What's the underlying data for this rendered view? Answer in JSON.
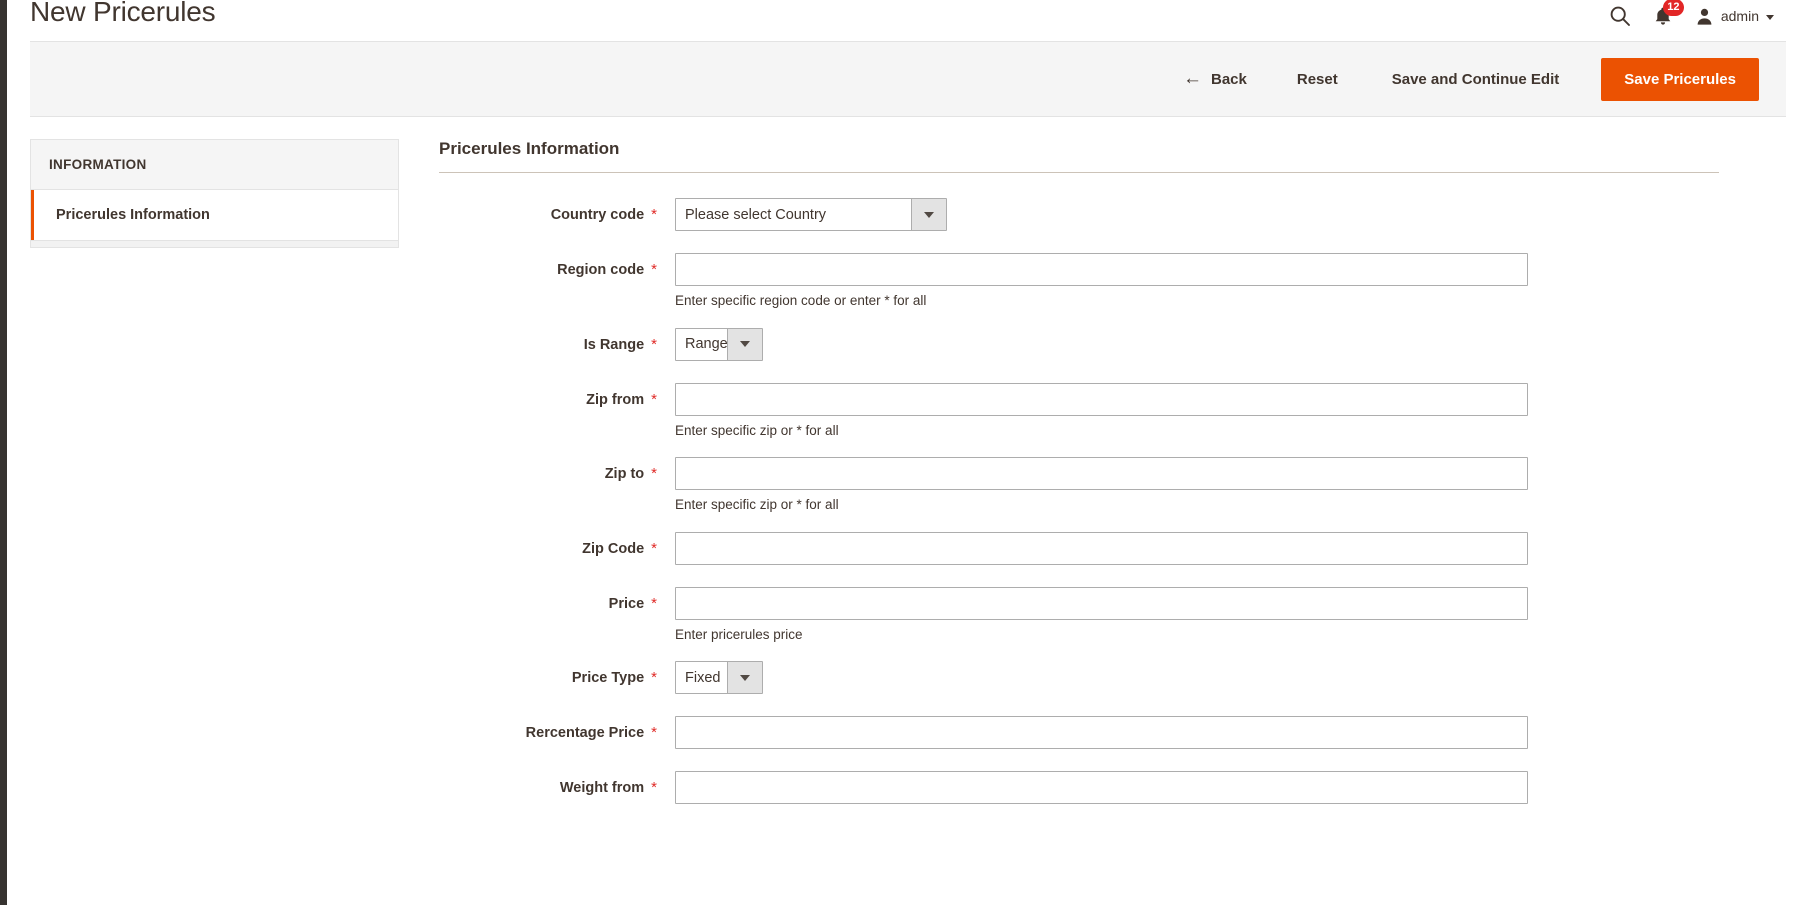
{
  "header": {
    "title": "New Pricerules",
    "search_icon": "search-icon",
    "bell_icon": "bell-icon",
    "notification_count": "12",
    "user_icon": "user-avatar-icon",
    "user_name": "admin",
    "caret_icon": "chevron-down-icon"
  },
  "toolbar": {
    "back_arrow": "←",
    "back_label": "Back",
    "reset_label": "Reset",
    "save_continue_label": "Save and Continue Edit",
    "save_label": "Save Pricerules",
    "primary_color": "#eb5202"
  },
  "sidebar": {
    "heading": "INFORMATION",
    "items": [
      {
        "label": "Pricerules Information",
        "active": true
      }
    ]
  },
  "form": {
    "section_title": "Pricerules Information",
    "fields": [
      {
        "label": "Country code",
        "required": "*",
        "type": "select",
        "width": "wide",
        "value": "Please select Country",
        "note": ""
      },
      {
        "label": "Region code",
        "required": "*",
        "type": "text",
        "value": "",
        "note": "Enter specific region code or enter * for all"
      },
      {
        "label": "Is Range",
        "required": "*",
        "type": "select",
        "width": "narrow",
        "value": "Range",
        "note": ""
      },
      {
        "label": "Zip from",
        "required": "*",
        "type": "text",
        "value": "",
        "note": "Enter specific zip or * for all"
      },
      {
        "label": "Zip to",
        "required": "*",
        "type": "text",
        "value": "",
        "note": "Enter specific zip or * for all"
      },
      {
        "label": "Zip Code",
        "required": "*",
        "type": "text",
        "value": "",
        "note": ""
      },
      {
        "label": "Price",
        "required": "*",
        "type": "text",
        "value": "",
        "note": "Enter pricerules price"
      },
      {
        "label": "Price Type",
        "required": "*",
        "type": "select",
        "width": "narrow",
        "value": "Fixed",
        "note": ""
      },
      {
        "label": "Rercentage Price",
        "required": "*",
        "type": "text",
        "value": "",
        "note": ""
      },
      {
        "label": "Weight from",
        "required": "*",
        "type": "text",
        "value": "",
        "note": ""
      }
    ]
  }
}
